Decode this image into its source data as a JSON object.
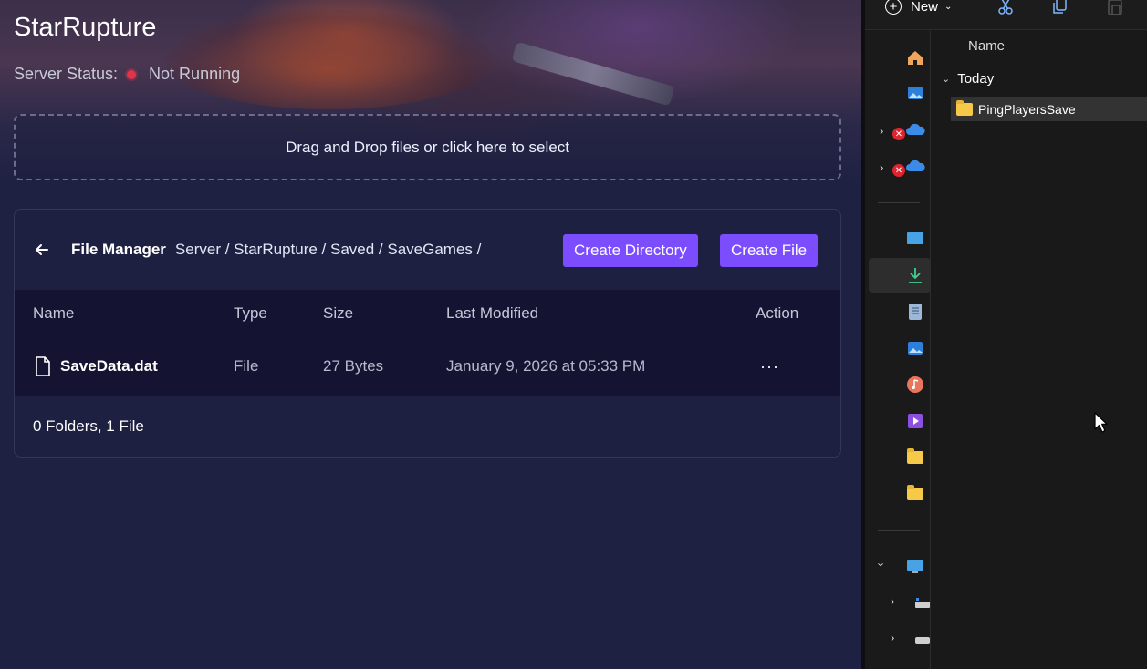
{
  "app": {
    "title": "StarRupture",
    "status_label": "Server Status:",
    "status_value": "Not Running",
    "status_color": "#e0344a",
    "accent": "#7c4dff"
  },
  "dropzone": {
    "text": "Drag and Drop files or click here to select"
  },
  "file_manager": {
    "title": "File Manager",
    "breadcrumb": "Server / StarRupture / Saved / SaveGames /",
    "create_directory_label": "Create Directory",
    "create_file_label": "Create File",
    "columns": [
      "Name",
      "Type",
      "Size",
      "Last Modified",
      "Action"
    ],
    "rows": [
      {
        "name": "SaveData.dat",
        "type": "File",
        "size": "27 Bytes",
        "modified": "January 9, 2026 at 05:33 PM",
        "action": "···"
      }
    ],
    "footer": "0 Folders, 1 File"
  },
  "explorer": {
    "new_label": "New",
    "column_name": "Name",
    "group": "Today",
    "items": [
      {
        "name": "PingPlayersSave",
        "icon": "folder-icon"
      }
    ],
    "nav_icons": [
      "home-icon",
      "gallery-icon",
      "onedrive-icon",
      "onedrive-icon",
      "desktop-icon",
      "downloads-icon",
      "documents-icon",
      "pictures-icon",
      "music-icon",
      "videos-icon",
      "folder-icon",
      "folder-icon",
      "this-pc-icon",
      "drive-icon",
      "drive-icon"
    ]
  }
}
